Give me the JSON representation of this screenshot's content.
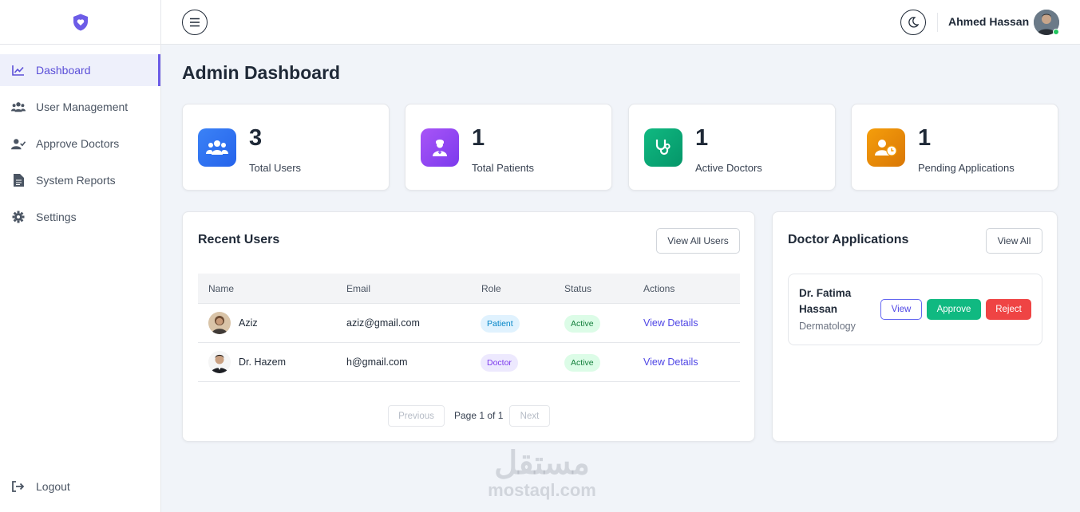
{
  "sidebar": {
    "items": [
      {
        "label": "Dashboard",
        "icon": "chart-line-icon",
        "active": true
      },
      {
        "label": "User Management",
        "icon": "users-icon"
      },
      {
        "label": "Approve Doctors",
        "icon": "user-check-icon"
      },
      {
        "label": "System Reports",
        "icon": "file-icon"
      },
      {
        "label": "Settings",
        "icon": "gear-icon"
      }
    ],
    "logout": "Logout"
  },
  "topbar": {
    "user_name": "Ahmed Hassan"
  },
  "page": {
    "title": "Admin Dashboard"
  },
  "stats": [
    {
      "value": "3",
      "label": "Total Users",
      "color": "#3b82f6",
      "icon": "users-icon"
    },
    {
      "value": "1",
      "label": "Total Patients",
      "color": "#8b5cf6",
      "icon": "patient-icon"
    },
    {
      "value": "1",
      "label": "Active Doctors",
      "color": "#10b981",
      "icon": "stethoscope-icon"
    },
    {
      "value": "1",
      "label": "Pending Applications",
      "color": "#f59e0b",
      "icon": "user-clock-icon"
    }
  ],
  "recent_users": {
    "title": "Recent Users",
    "view_all": "View All Users",
    "columns": [
      "Name",
      "Email",
      "Role",
      "Status",
      "Actions"
    ],
    "rows": [
      {
        "name": "Aziz",
        "email": "aziz@gmail.com",
        "role": "Patient",
        "status": "Active",
        "action": "View Details"
      },
      {
        "name": "Dr. Hazem",
        "email": "h@gmail.com",
        "role": "Doctor",
        "status": "Active",
        "action": "View Details"
      }
    ],
    "pagination": {
      "previous": "Previous",
      "page_text": "Page 1 of 1",
      "next": "Next"
    }
  },
  "doctor_applications": {
    "title": "Doctor Applications",
    "view_all": "View All",
    "items": [
      {
        "name": "Dr. Fatima Hassan",
        "specialty": "Dermatology",
        "view": "View",
        "approve": "Approve",
        "reject": "Reject"
      }
    ]
  },
  "watermark": {
    "arabic": "مستقل",
    "latin": "mostaql.com"
  },
  "colors": {
    "accent": "#6c5ce7",
    "approve": "#10b981",
    "reject": "#ef4444"
  }
}
